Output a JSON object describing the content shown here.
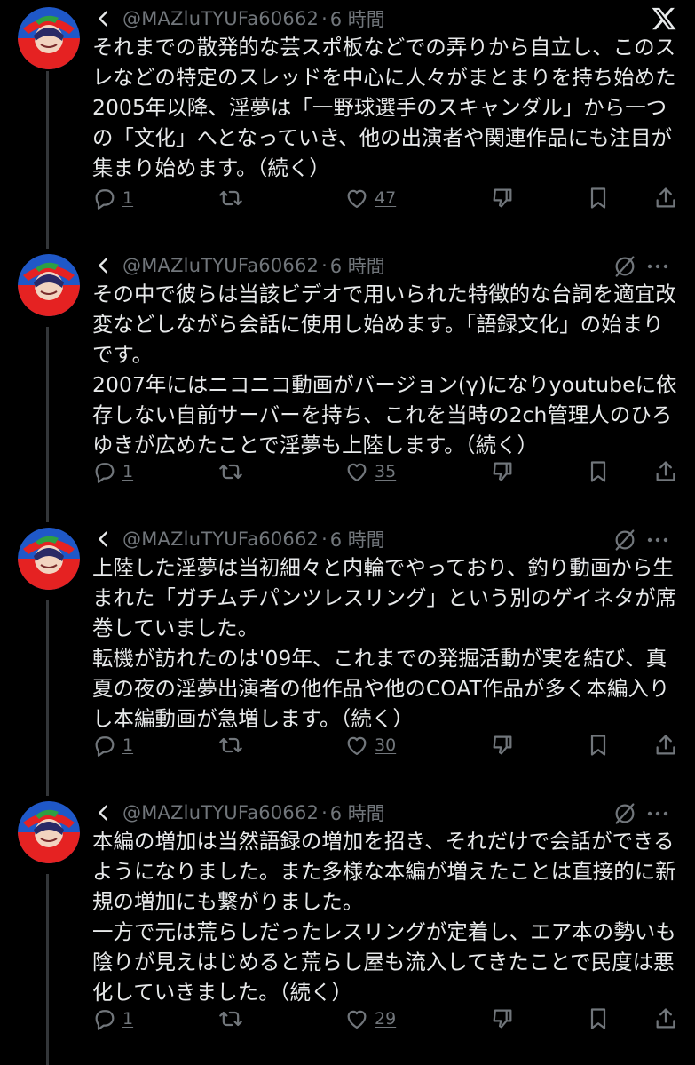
{
  "app": {
    "logo_icon": "x-logo"
  },
  "thread": [
    {
      "handle": "@MAZluTYUFa60662",
      "separator": "·",
      "time": "6 時間",
      "text": "それまでの散発的な芸スポ板などでの弄りから自立し、このスレなどの特定のスレッドを中心に人々がまとまりを持ち始めた2005年以降、淫夢は「一野球選手のスキャンダル」から一つの「文化」へとなっていき、他の出演者や関連作品にも注目が集まり始めます。（続く）",
      "replies": "1",
      "retweets": "",
      "likes": "47"
    },
    {
      "handle": "@MAZluTYUFa60662",
      "separator": "·",
      "time": "6 時間",
      "text": "その中で彼らは当該ビデオで用いられた特徴的な台詞を適宜改変などしながら会話に使用し始めます。「語録文化」の始まりです。\n2007年にはニコニコ動画がバージョン(γ)になりyoutubeに依存しない自前サーバーを持ち、これを当時の2ch管理人のひろゆきが広めたことで淫夢も上陸します。（続く）",
      "replies": "1",
      "retweets": "",
      "likes": "35"
    },
    {
      "handle": "@MAZluTYUFa60662",
      "separator": "·",
      "time": "6 時間",
      "text": "上陸した淫夢は当初細々と内輪でやっており、釣り動画から生まれた「ガチムチパンツレスリング」という別のゲイネタが席巻していました。\n転機が訪れたのは'09年、これまでの発掘活動が実を結び、真夏の夜の淫夢出演者の他作品や他のCOAT作品が多く本編入りし本編動画が急増します。（続く）",
      "replies": "1",
      "retweets": "",
      "likes": "30"
    },
    {
      "handle": "@MAZluTYUFa60662",
      "separator": "·",
      "time": "6 時間",
      "text": "本編の増加は当然語録の増加を招き、それだけで会話ができるようになりました。また多様な本編が増えたことは直接的に新規の増加にも繋がりました。\n一方で元は荒らしだったレスリングが定着し、エア本の勢いも陰りが見えはじめると荒らし屋も流入してきたことで民度は悪化していきました。（続く）",
      "replies": "1",
      "retweets": "",
      "likes": "29"
    }
  ]
}
